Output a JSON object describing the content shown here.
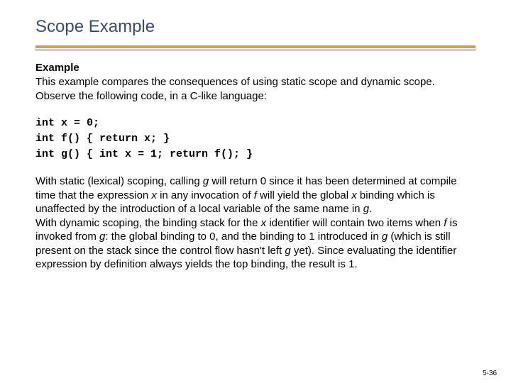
{
  "slide": {
    "title": "Scope Example",
    "subhead": "Example",
    "intro": "This example compares the consequences of using static scope and dynamic scope. Observe the following code, in a C-like language:",
    "code": "int x = 0;\nint f() { return x; }\nint g() { int x = 1; return f(); }",
    "body_html": "With static (lexical) scoping, calling <em>g</em> will return 0 since it has been determined at compile time that the expression <em>x</em> in any invocation of <em>f</em> will yield the global <em>x</em> binding which is unaffected by the introduction of a local variable of the same name in <em>g</em>.<br>With dynamic scoping, the binding stack for the <em>x</em> identifier will contain two items when <em>f</em> is invoked from <em>g</em>: the global binding to 0, and the binding to 1 introduced in <em>g</em> (which is still present on the stack since the control flow hasn't left <em>g</em> yet). Since evaluating the identifier expression by definition always yields the top binding, the result is 1.",
    "page_number": "5-36"
  }
}
